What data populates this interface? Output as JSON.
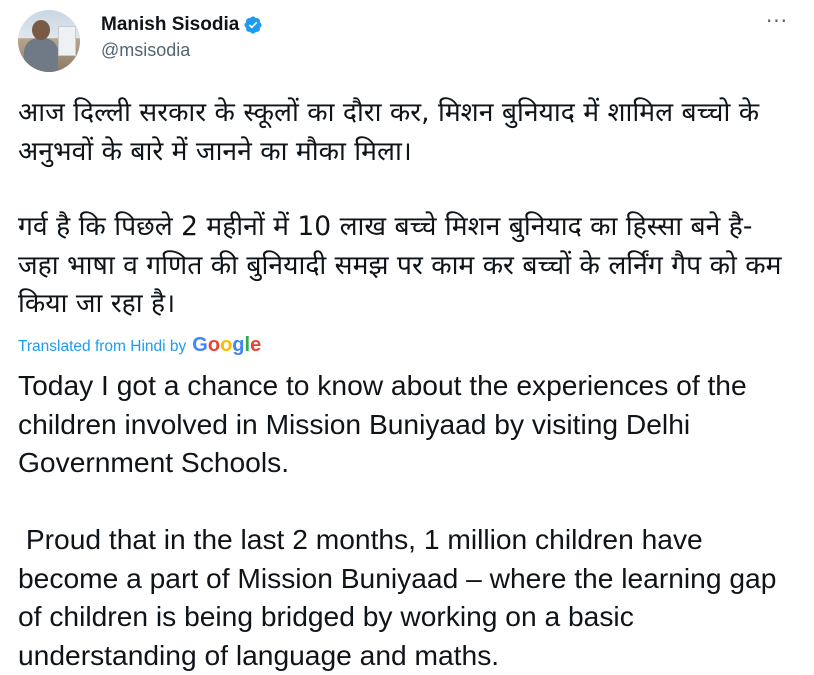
{
  "author": {
    "name": "Manish Sisodia",
    "handle": "@msisodia",
    "verified_icon": "verified-badge-icon",
    "accent_color": "#1d9bf0"
  },
  "menu": {
    "more_icon": "more-horizontal-icon",
    "more_glyph": "···"
  },
  "tweet": {
    "hindi_paragraphs": [
      "आज दिल्ली सरकार के स्कूलों का दौरा कर, मिशन बुनियाद में शामिल बच्चो के अनुभवों के बारे में जानने का मौका मिला।",
      "गर्व है कि पिछले 2 महीनों में 10 लाख बच्चे मिशन बुनियाद का हिस्सा बने है- जहा भाषा व गणित की बुनियादी समझ पर काम कर बच्चों के लर्निंग गैप को कम किया जा रहा है।"
    ],
    "translation_label": "Translated from Hindi by",
    "translation_provider": "Google",
    "english_paragraphs": [
      "Today I got a chance to know about the experiences of the children involved in Mission Buniyaad by visiting Delhi Government Schools.",
      " Proud that in the last 2 months, 1 million children have become a part of Mission Buniyaad – where the learning gap of children is being bridged by working on a basic understanding of language and maths."
    ]
  },
  "colors": {
    "text_primary": "#0f1419",
    "text_secondary": "#536471",
    "link": "#1d9bf0",
    "google_blue": "#4285f4",
    "google_red": "#ea4335",
    "google_yellow": "#fbbc05",
    "google_green": "#34a853"
  }
}
